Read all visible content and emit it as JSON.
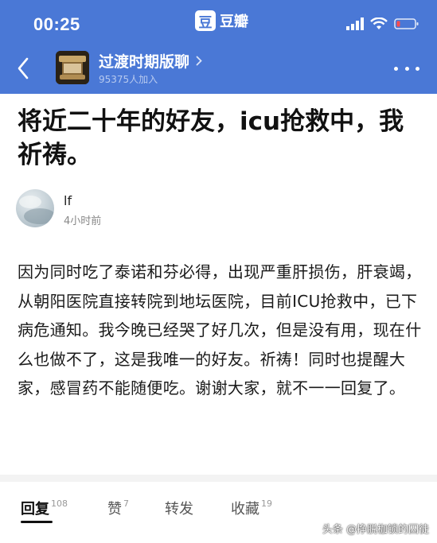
{
  "status_bar": {
    "time": "00:25"
  },
  "app": {
    "logo_char": "豆",
    "name": "豆瓣"
  },
  "group": {
    "name": "过渡时期版聊",
    "members": "95375人加入"
  },
  "post": {
    "title": "将近二十年的好友，icu抢救中，我祈祷。",
    "author": "lf",
    "time": "4小时前",
    "body": "因为同时吃了泰诺和芬必得，出现严重肝损伤，肝衰竭，从朝阳医院直接转院到地坛医院，目前ICU抢救中，已下病危通知。我今晚已经哭了好几次，但是没有用，现在什么也做不了，这是我唯一的好友。祈祷！同时也提醒大家，感冒药不能随便吃。谢谢大家，就不一一回复了。"
  },
  "tabs": [
    {
      "label": "回复",
      "count": "108"
    },
    {
      "label": "赞",
      "count": "7"
    },
    {
      "label": "转发",
      "count": ""
    },
    {
      "label": "收藏",
      "count": "19"
    }
  ],
  "watermark": "头条 @挣脱枷锁的囚徒",
  "colors": {
    "header_blue": "#4a78d6",
    "text_primary": "#111111",
    "text_secondary": "#888888"
  }
}
